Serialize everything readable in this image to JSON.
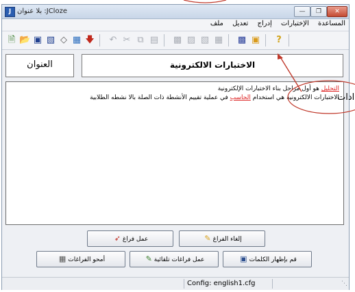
{
  "window": {
    "title": "بلا عنوان :JCloze",
    "minimize_glyph": "—",
    "restore_glyph": "❐",
    "close_glyph": "✕"
  },
  "menu": {
    "items": [
      "المساعدة",
      "الإختبارات",
      "إدراج",
      "تعديل",
      "ملف"
    ]
  },
  "labels": {
    "title_label": "العنوان",
    "title_value": "الاختبارات الالكترونية"
  },
  "content": {
    "line1_gap": "التحليل",
    "line1_rest": " هو أول مراحل بناء الاختبارات الإلكترونية",
    "line2_start": "الاختبارات الالكترونية هي استخدام ",
    "line2_gap": "الحاسب",
    "line2_rest": " في عملية تقييم الأنشطة ذات الصلة بالا نشطه الطلابية"
  },
  "buttons": {
    "make_gap": "عمل فراغ",
    "clear_gap": "إلغاء الفراغ",
    "delete_gaps": "أمحو الفراغات",
    "auto_gaps": "عمل فراغات تلقائية",
    "show_words": "قم بإظهار الكلمات"
  },
  "status": {
    "config": "Config: english1.cfg"
  },
  "callout": {
    "text": "ادات"
  },
  "colors": {
    "gap_text": "#d22222",
    "callout_stroke": "#c0392b"
  }
}
